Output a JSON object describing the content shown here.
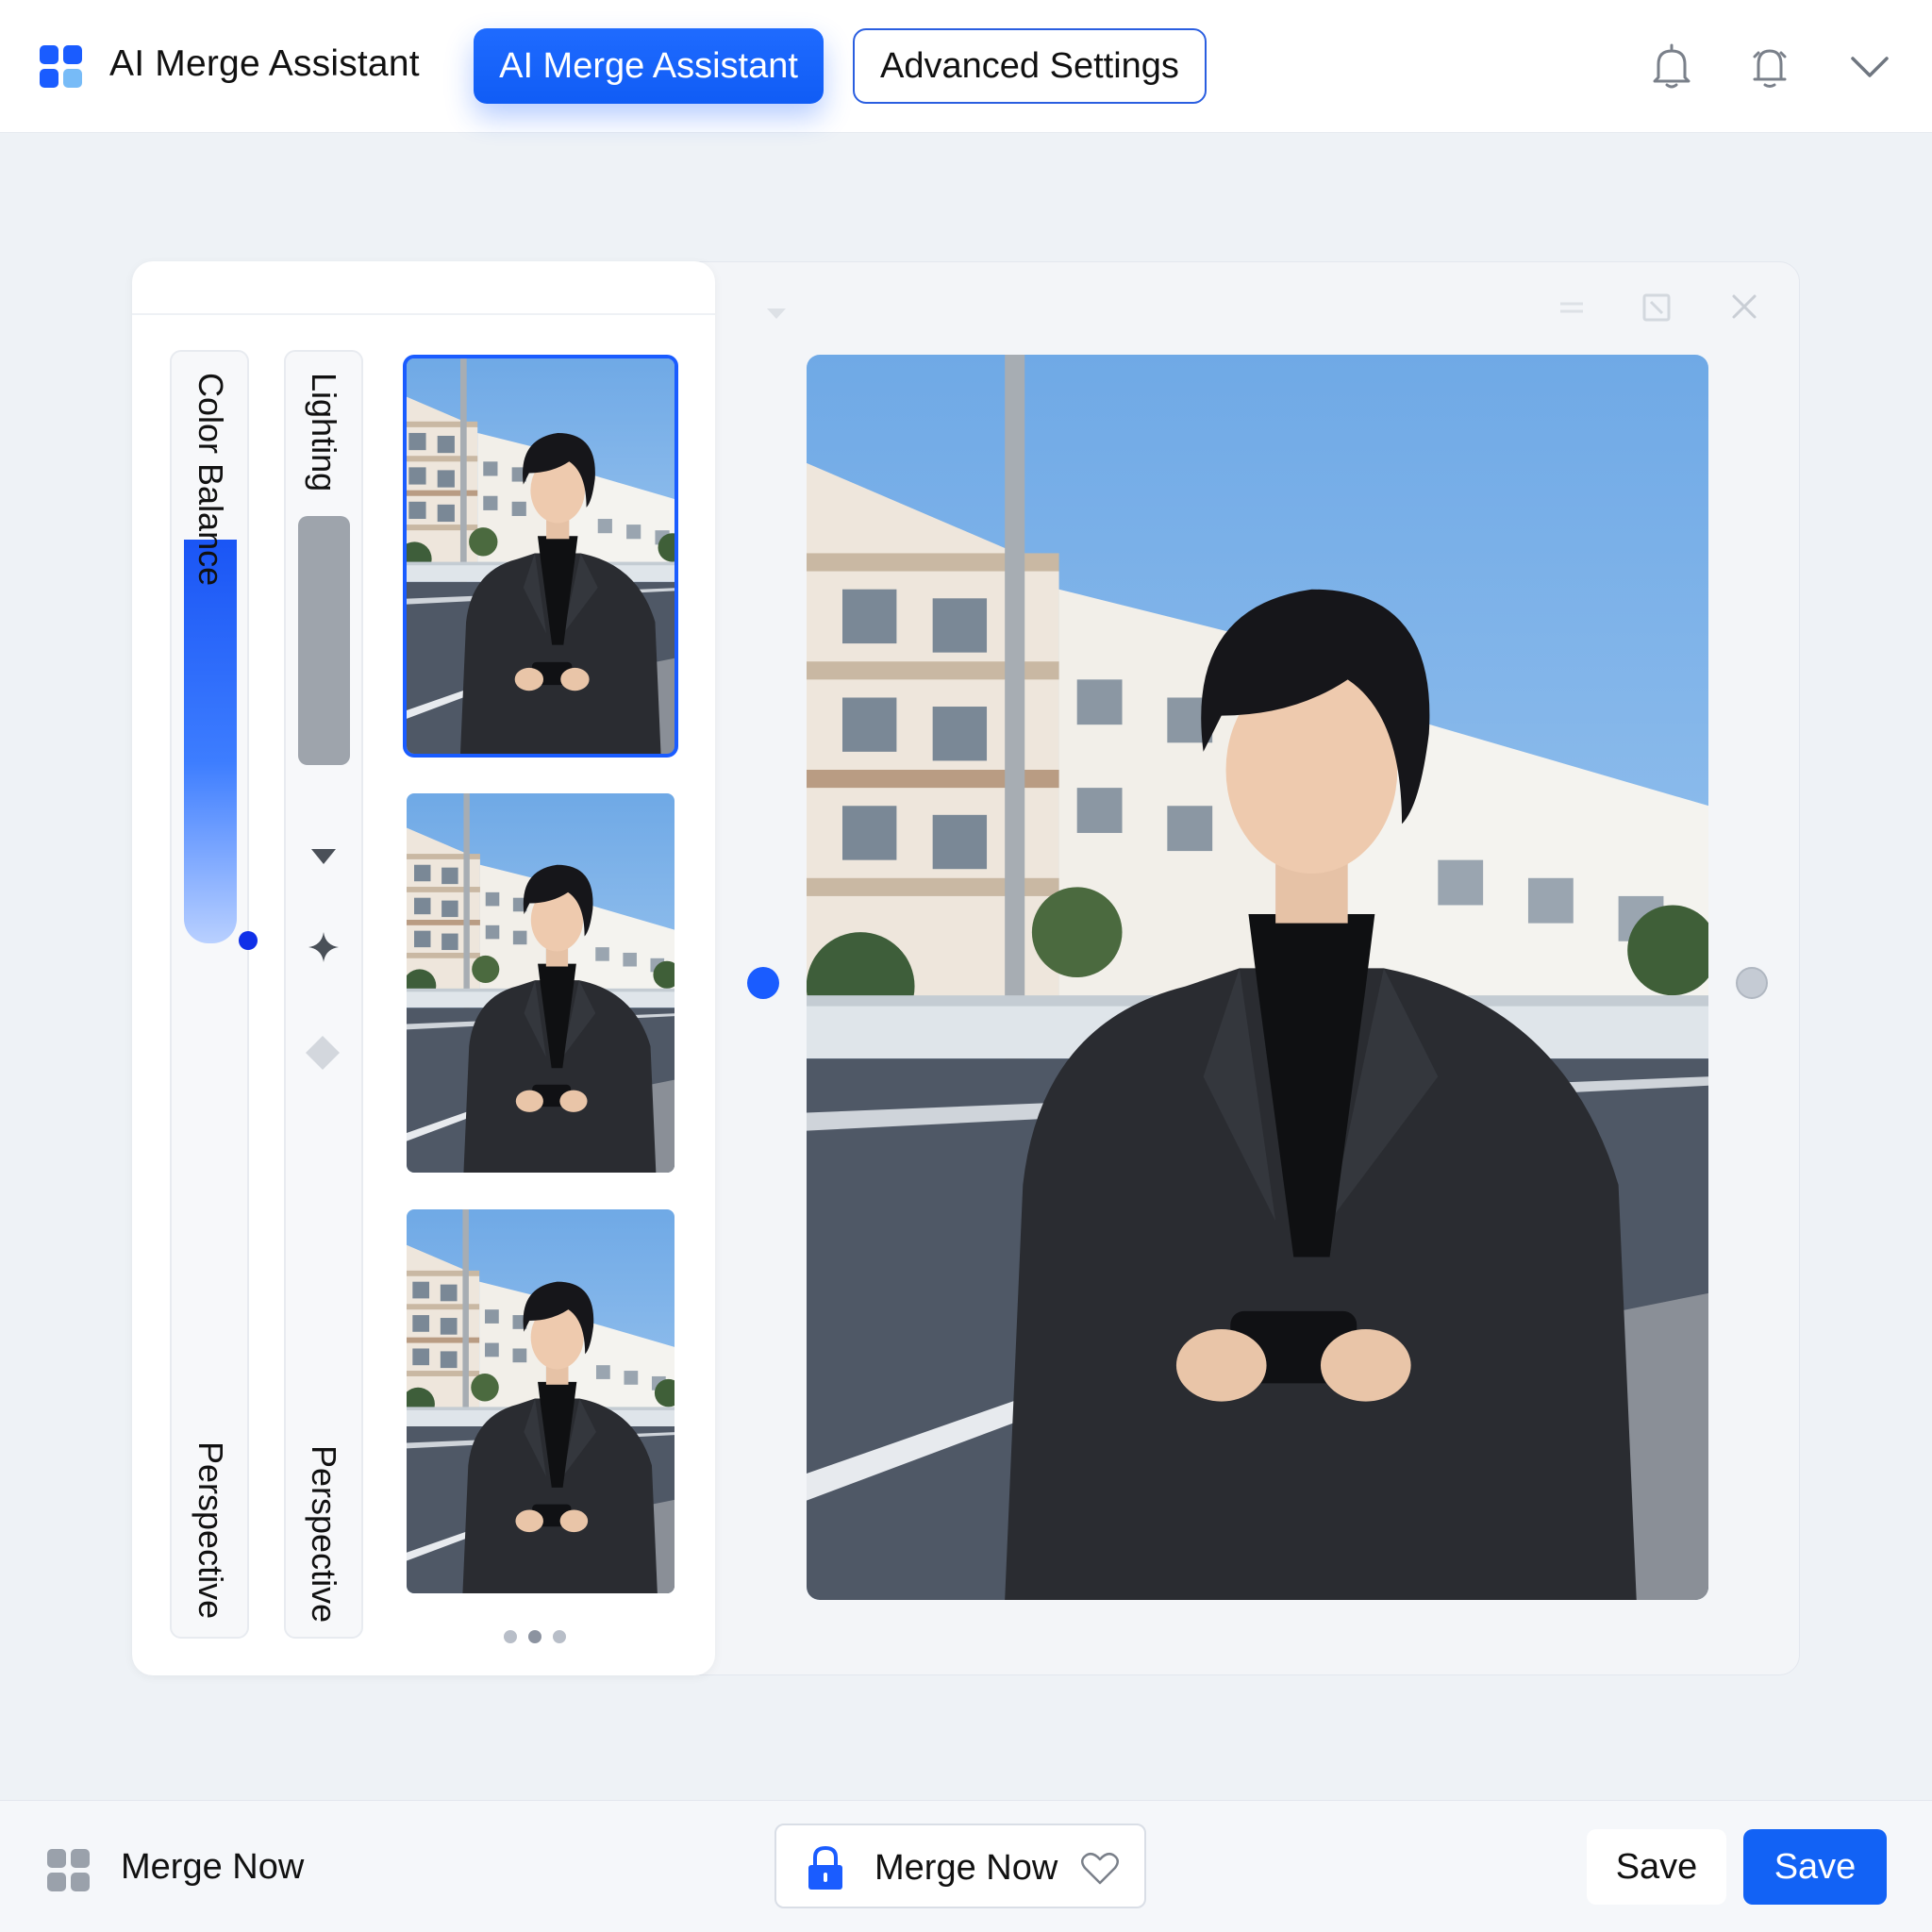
{
  "header": {
    "app_title": "AI Merge Assistant",
    "logo_icon": "app-grid-icon",
    "tabs": [
      {
        "label": "AI Merge Assistant",
        "active": true
      },
      {
        "label": "Advanced Settings",
        "active": false
      }
    ],
    "icons": [
      "bell-icon",
      "notification-icon",
      "chevron-down-icon"
    ]
  },
  "left_panel": {
    "sliders": [
      {
        "label": "Color Balance",
        "bottom_label": "Perspective",
        "value": 0.36
      },
      {
        "label": "Lighting",
        "bottom_label": "Perspective"
      }
    ],
    "tool_icons": [
      "triangle-down-icon",
      "sparkle-icon",
      "diamond-icon"
    ],
    "thumbnails": [
      {
        "name": "variant-1",
        "selected": true
      },
      {
        "name": "variant-2",
        "selected": false
      },
      {
        "name": "variant-3",
        "selected": false
      }
    ],
    "pager_dots": 3
  },
  "preview": {
    "window_icons": [
      "minimize-icon",
      "maximize-icon",
      "close-icon"
    ]
  },
  "footer": {
    "merge_label": "Merge Now",
    "center_button_label": "Merge Now",
    "save_label": "Save",
    "save_primary_label": "Save"
  },
  "colors": {
    "accent": "#1a5cff",
    "background": "#eef2f6",
    "sky": "#86b9ec"
  }
}
